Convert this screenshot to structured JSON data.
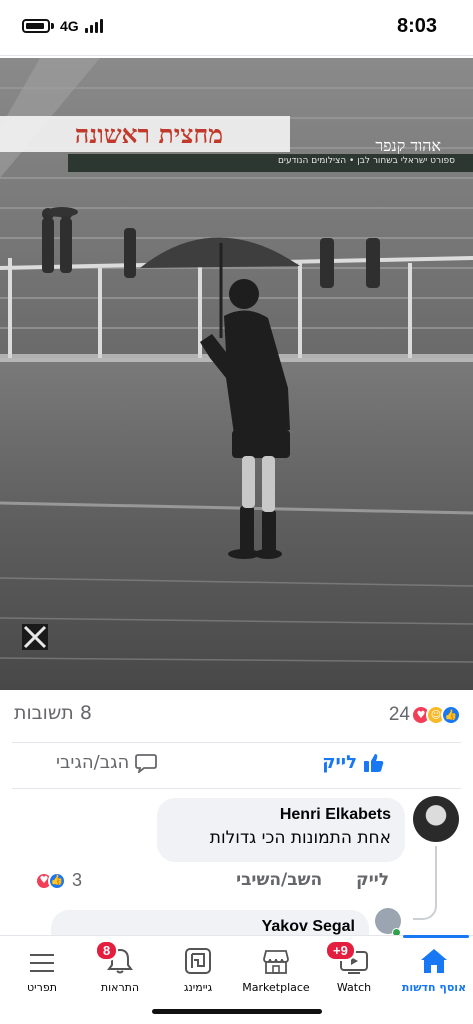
{
  "status_bar": {
    "network": "4G",
    "time": "8:03"
  },
  "post": {
    "image": {
      "book_title": "מחצית ראשונה",
      "book_author": "אהוד קנפר",
      "book_subtitle": "ספורט ישראלי בשחור לבן • הצילומים הנודעים",
      "publisher_mark": "X"
    },
    "reaction_count": "24",
    "comments_count": "8 תשובות",
    "like_label": "לייק",
    "reply_label": "הגב/הגיבי"
  },
  "comments": [
    {
      "author": "Henri Elkabets",
      "text": "אחת התמונות הכי גדולות",
      "like_label": "לייק",
      "reply_label": "השב/השיבי",
      "reaction_count": "3"
    },
    {
      "author": "Yakov Segal"
    }
  ],
  "bottom_nav": [
    {
      "label": "אוסף חדשות",
      "icon": "home-icon",
      "active": true
    },
    {
      "label": "Watch",
      "icon": "watch-icon",
      "badge": "+9"
    },
    {
      "label": "Marketplace",
      "icon": "marketplace-icon"
    },
    {
      "label": "גיימינג",
      "icon": "gaming-icon"
    },
    {
      "label": "התראות",
      "icon": "bell-icon",
      "badge": "8"
    },
    {
      "label": "תפריט",
      "icon": "menu-icon"
    }
  ],
  "colors": {
    "accent": "#1877f2",
    "badge": "#e41e3f",
    "muted": "#65676b",
    "bubble": "#f0f2f5"
  }
}
